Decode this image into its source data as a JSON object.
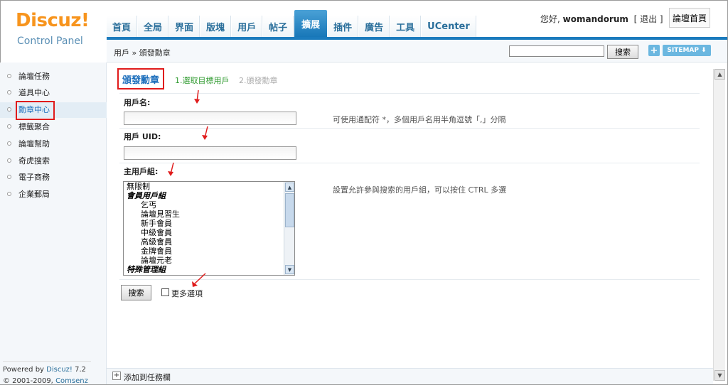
{
  "app": {
    "logo_main": "Discuz!",
    "logo_sub": "Control Panel"
  },
  "nav": {
    "items": [
      {
        "label": "首頁"
      },
      {
        "label": "全局"
      },
      {
        "label": "界面"
      },
      {
        "label": "版塊"
      },
      {
        "label": "用戶"
      },
      {
        "label": "帖子"
      },
      {
        "label": "擴展",
        "active": true
      },
      {
        "label": "插件"
      },
      {
        "label": "廣告"
      },
      {
        "label": "工具"
      },
      {
        "label": "UCenter"
      }
    ]
  },
  "user": {
    "greeting": "您好,",
    "username": "womandorum",
    "logout": "[ 退出 ]",
    "home_button": "論壇首頁"
  },
  "breadcrumb": {
    "text": "用戶 » 頒發勳章"
  },
  "search": {
    "value": "",
    "button": "搜索"
  },
  "sitemap": {
    "plus": "+",
    "label": "SITEMAP ⬇"
  },
  "sidebar": {
    "items": [
      {
        "label": "論壇任務"
      },
      {
        "label": "道具中心"
      },
      {
        "label": "勳章中心",
        "active": true
      },
      {
        "label": "標籤聚合"
      },
      {
        "label": "論壇幫助"
      },
      {
        "label": "奇虎搜索"
      },
      {
        "label": "電子商務"
      },
      {
        "label": "企業郵局"
      }
    ],
    "footer": {
      "powered": "Powered by",
      "brand": "Discuz!",
      "version": "7.2",
      "copyright": "© 2001-2009,",
      "company": "Comsenz Inc."
    }
  },
  "main": {
    "title": "頒發勳章",
    "step1": "1.選取目標用戶",
    "step2": "2.頒發勳章",
    "username_label": "用戶名:",
    "username_value": "",
    "username_hint": "可使用通配符 *，多個用戶名用半角逗號「,」分隔",
    "uid_label": "用戶 UID:",
    "uid_value": "",
    "group_label": "主用戶組:",
    "group_hint": "設置允許參與搜索的用戶組，可以按住 CTRL 多選",
    "group_options": [
      {
        "label": "無限制",
        "kind": "opt"
      },
      {
        "label": "會員用戶組",
        "kind": "group"
      },
      {
        "label": "乞丐",
        "kind": "sub"
      },
      {
        "label": "論壇見習生",
        "kind": "sub"
      },
      {
        "label": "新手會員",
        "kind": "sub"
      },
      {
        "label": "中級會員",
        "kind": "sub"
      },
      {
        "label": "高級會員",
        "kind": "sub"
      },
      {
        "label": "金牌會員",
        "kind": "sub"
      },
      {
        "label": "論壇元老",
        "kind": "sub"
      },
      {
        "label": "特殊管理組",
        "kind": "group"
      }
    ],
    "submit": "搜索",
    "more_options": "更多選項"
  },
  "bottombar": {
    "plus": "+",
    "label": "添加到任務欄"
  },
  "colors": {
    "accent": "#1b7bbd",
    "highlight": "#e01b1b",
    "logo": "#f7941d"
  }
}
